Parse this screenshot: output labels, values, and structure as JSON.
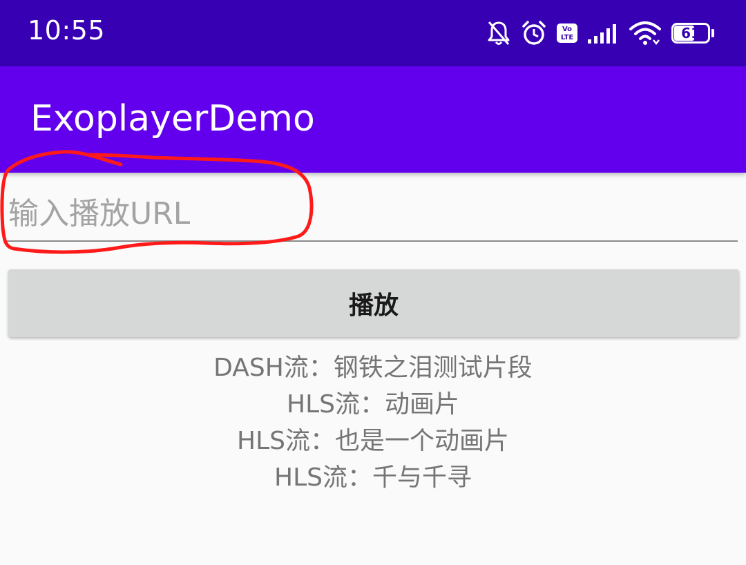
{
  "status_bar": {
    "time": "10:55",
    "icons": [
      "bell-off-icon",
      "alarm-icon",
      "volte-icon",
      "signal-icon",
      "wifi-icon",
      "battery-icon"
    ],
    "volte_text": "Vo LTE",
    "battery_level": "61",
    "background": "#3700b3"
  },
  "app_bar": {
    "title": "ExoplayerDemo",
    "background": "#6200ee"
  },
  "url_input": {
    "placeholder": "输入播放URL",
    "value": ""
  },
  "play_button": {
    "label": "播放"
  },
  "streams": [
    {
      "label": "DASH流：钢铁之泪测试片段"
    },
    {
      "label": "HLS流：动画片"
    },
    {
      "label": "HLS流：也是一个动画片"
    },
    {
      "label": "HLS流：千与千寻"
    }
  ],
  "annotation": {
    "color": "#ff1a1a",
    "shape": "hand-drawn-circle-around-url-input"
  }
}
